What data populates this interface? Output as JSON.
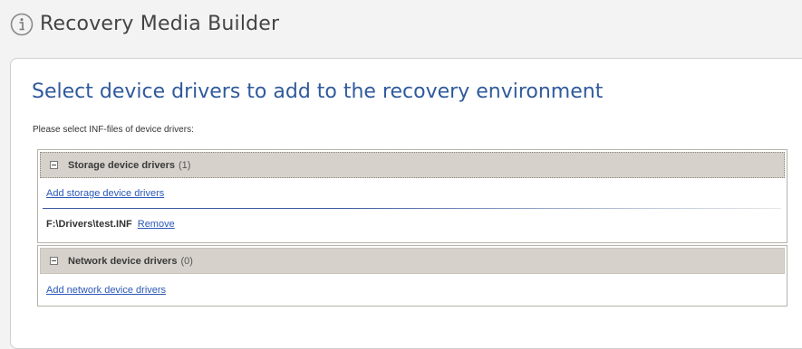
{
  "window": {
    "title": "Recovery Media Builder"
  },
  "page": {
    "heading": "Select device drivers to add to the recovery environment",
    "instruction": "Please select INF-files of device drivers:"
  },
  "groups": {
    "storage": {
      "name": "Storage device drivers",
      "count": "(1)",
      "add_link": "Add storage device drivers",
      "drivers": [
        {
          "path": "F:\\Drivers\\test.INF",
          "remove_label": "Remove"
        }
      ]
    },
    "network": {
      "name": "Network device drivers",
      "count": "(0)",
      "add_link": "Add network device drivers"
    }
  },
  "colors": {
    "heading": "#2f5a9c",
    "link": "#2b58b8",
    "group_header_bg": "#d6d2cb"
  },
  "icons": {
    "title_icon": "info-circle-icon",
    "collapse_icon": "minus-box-icon"
  }
}
